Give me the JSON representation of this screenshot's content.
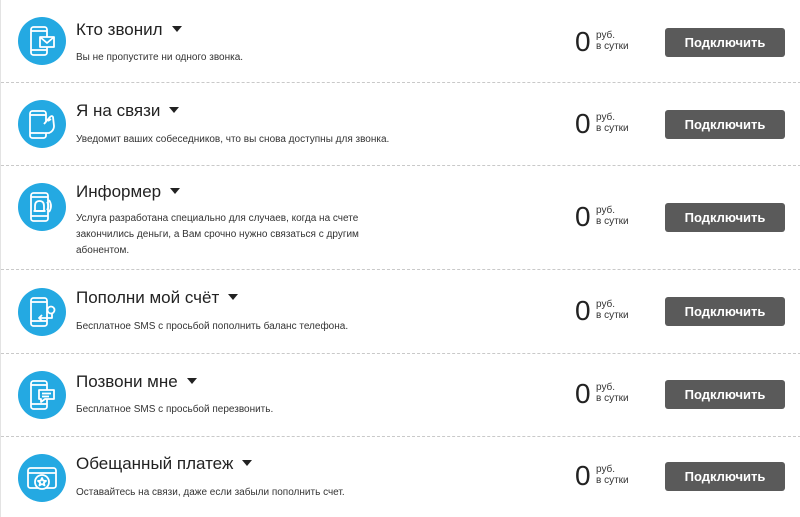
{
  "accent_color": "#24a9e2",
  "button_color": "#5a5a5a",
  "services": [
    {
      "icon": "phone-envelope-icon",
      "title": "Кто звонил",
      "description": "Вы не пропустите ни одного звонка.",
      "price": "0",
      "price_unit_line1": "руб.",
      "price_unit_line2": "в сутки",
      "button_label": "Подключить"
    },
    {
      "icon": "phone-hand-icon",
      "title": "Я на связи",
      "description": "Уведомит ваших собеседников, что вы снова доступны для звонка.",
      "price": "0",
      "price_unit_line1": "руб.",
      "price_unit_line2": "в сутки",
      "button_label": "Подключить"
    },
    {
      "icon": "phone-bell-icon",
      "title": "Информер",
      "description": "Услуга разработана специально для случаев, когда на счете закончились деньги, а Вам срочно нужно связаться с другим абонентом.",
      "price": "0",
      "price_unit_line1": "руб.",
      "price_unit_line2": "в сутки",
      "button_label": "Подключить"
    },
    {
      "icon": "phone-topup-icon",
      "title": "Пополни мой счёт",
      "description": "Бесплатное SMS с просьбой пополнить баланс телефона.",
      "price": "0",
      "price_unit_line1": "руб.",
      "price_unit_line2": "в сутки",
      "button_label": "Подключить"
    },
    {
      "icon": "phone-message-icon",
      "title": "Позвони мне",
      "description": "Бесплатное SMS с просьбой перезвонить.",
      "price": "0",
      "price_unit_line1": "руб.",
      "price_unit_line2": "в сутки",
      "button_label": "Подключить"
    },
    {
      "icon": "card-star-icon",
      "title": "Обещанный платеж",
      "description": "Оставайтесь на связи, даже если забыли пополнить счет.",
      "price": "0",
      "price_unit_line1": "руб.",
      "price_unit_line2": "в сутки",
      "button_label": "Подключить"
    }
  ]
}
